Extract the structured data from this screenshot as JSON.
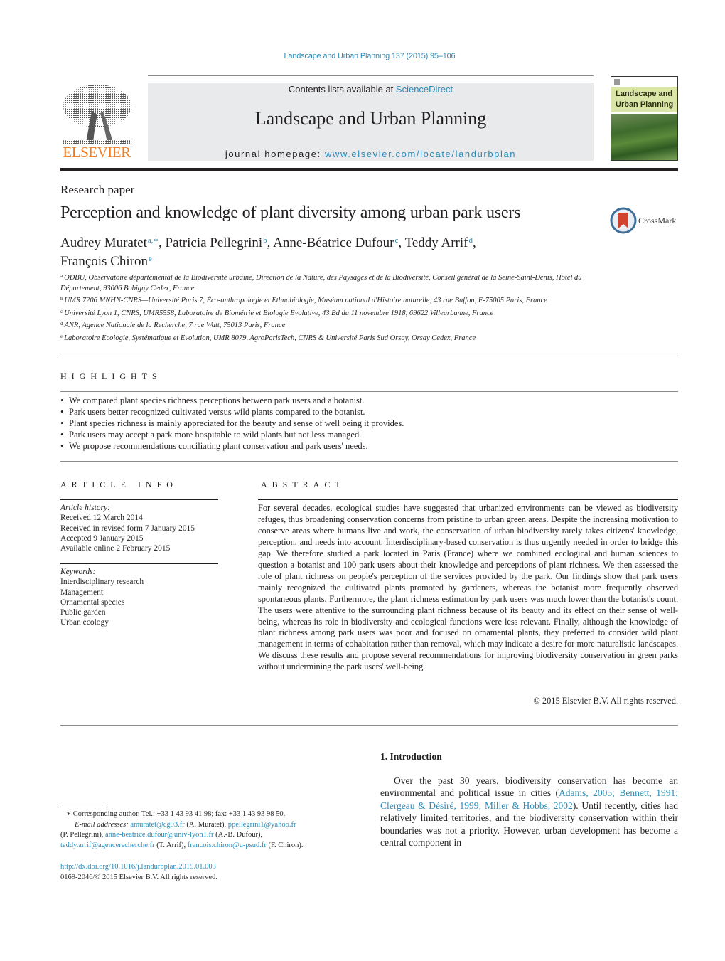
{
  "journal_ref": "Landscape and Urban Planning 137 (2015) 95–106",
  "masthead": {
    "publisher_logo": "ELSEVIER",
    "contents_prefix": "Contents lists available at ",
    "contents_link": "ScienceDirect",
    "journal_name": "Landscape and Urban Planning",
    "homepage_prefix": "journal homepage: ",
    "homepage_link": "www.elsevier.com/locate/landurbplan",
    "cover_title_line1": "Landscape and",
    "cover_title_line2": "Urban Planning"
  },
  "article": {
    "type": "Research paper",
    "title": "Perception and knowledge of plant diversity among urban park users",
    "crossmark_label": "CrossMark",
    "authors": [
      {
        "name": "Audrey Muratet",
        "sup": "a,∗",
        "sep": ", "
      },
      {
        "name": "Patricia Pellegrini",
        "sup": "b",
        "sep": ", "
      },
      {
        "name": "Anne-Béatrice Dufour",
        "sup": "c",
        "sep": ", "
      },
      {
        "name": "Teddy Arrif",
        "sup": "d",
        "sep": ","
      },
      {
        "name": "François Chiron",
        "sup": "e",
        "sep": ""
      }
    ],
    "affiliations": [
      {
        "key": "a",
        "text": "ODBU, Observatoire départemental de la Biodiversité urbaine, Direction de la Nature, des Paysages et de la Biodiversité, Conseil général de la Seine-Saint-Denis, Hôtel du Département, 93006 Bobigny Cedex, France"
      },
      {
        "key": "b",
        "text": "UMR 7206 MNHN-CNRS—Université Paris 7, Éco-anthropologie et Ethnobiologie, Muséum national d'Histoire naturelle, 43 rue Buffon, F-75005 Paris, France"
      },
      {
        "key": "c",
        "text": "Université Lyon 1, CNRS, UMR5558, Laboratoire de Biométrie et Biologie Evolutive, 43 Bd du 11 novembre 1918, 69622 Villeurbanne, France"
      },
      {
        "key": "d",
        "text": "ANR, Agence Nationale de la Recherche, 7 rue Watt, 75013 Paris, France"
      },
      {
        "key": "e",
        "text": "Laboratoire Ecologie, Systématique et Evolution, UMR 8079, AgroParisTech, CNRS & Université Paris Sud Orsay, Orsay Cedex, France"
      }
    ]
  },
  "highlights": {
    "heading": "HIGHLIGHTS",
    "items": [
      "We compared plant species richness perceptions between park users and a botanist.",
      "Park users better recognized cultivated versus wild plants compared to the botanist.",
      "Plant species richness is mainly appreciated for the beauty and sense of well being it provides.",
      "Park users may accept a park more hospitable to wild plants but not less managed.",
      "We propose recommendations conciliating plant conservation and park users' needs."
    ]
  },
  "article_info": {
    "heading": "ARTICLE INFO",
    "history_label": "Article history:",
    "history": [
      "Received 12 March 2014",
      "Received in revised form 7 January 2015",
      "Accepted 9 January 2015",
      "Available online 2 February 2015"
    ],
    "keywords_label": "Keywords:",
    "keywords": [
      "Interdisciplinary research",
      "Management",
      "Ornamental species",
      "Public garden",
      "Urban ecology"
    ]
  },
  "abstract": {
    "heading": "ABSTRACT",
    "text": "For several decades, ecological studies have suggested that urbanized environments can be viewed as biodiversity refuges, thus broadening conservation concerns from pristine to urban green areas. Despite the increasing motivation to conserve areas where humans live and work, the conservation of urban biodiversity rarely takes citizens' knowledge, perception, and needs into account. Interdisciplinary-based conservation is thus urgently needed in order to bridge this gap. We therefore studied a park located in Paris (France) where we combined ecological and human sciences to question a botanist and 100 park users about their knowledge and perceptions of plant richness. We then assessed the role of plant richness on people's perception of the services provided by the park. Our findings show that park users mainly recognized the cultivated plants promoted by gardeners, whereas the botanist more frequently observed spontaneous plants. Furthermore, the plant richness estimation by park users was much lower than the botanist's count. The users were attentive to the surrounding plant richness because of its beauty and its effect on their sense of well-being, whereas its role in biodiversity and ecological functions were less relevant. Finally, although the knowledge of plant richness among park users was poor and focused on ornamental plants, they preferred to consider wild plant management in terms of cohabitation rather than removal, which may indicate a desire for more naturalistic landscapes. We discuss these results and propose several recommendations for improving biodiversity conservation in green parks without undermining the park users' well-being.",
    "copyright": "© 2015 Elsevier B.V. All rights reserved."
  },
  "footnotes": {
    "corresponding": "∗  Corresponding author. Tel.: +33 1 43 93 41 98; fax: +33 1 43 93 98 50.",
    "email_label": "E-mail addresses:",
    "emails": [
      {
        "address": "amuratet@cg93.fr",
        "who": " (A. Muratet), "
      },
      {
        "address": "ppellegrini1@yahoo.fr",
        "who": ""
      },
      {
        "address": "",
        "who": "(P. Pellegrini), "
      },
      {
        "address": "anne-beatrice.dufour@univ-lyon1.fr",
        "who": " (A.-B. Dufour),"
      },
      {
        "address": "teddy.arrif@agencerecherche.fr",
        "who": " (T. Arrif), "
      },
      {
        "address": "francois.chiron@u-psud.fr",
        "who": " (F. Chiron)."
      }
    ],
    "doi": "http://dx.doi.org/10.1016/j.landurbplan.2015.01.003",
    "issn_copyright": "0169-2046/© 2015 Elsevier B.V. All rights reserved."
  },
  "introduction": {
    "heading": "1.  Introduction",
    "text_before": "Over the past 30 years, biodiversity conservation has become an environmental and political issue in cities (",
    "citations": "Adams, 2005; Bennett, 1991; Clergeau & Désiré, 1999; Miller & Hobbs, 2002",
    "text_after": "). Until recently, cities had relatively limited territories, and the biodiversity conservation within their boundaries was not a priority. However, urban development has become a central component in"
  }
}
